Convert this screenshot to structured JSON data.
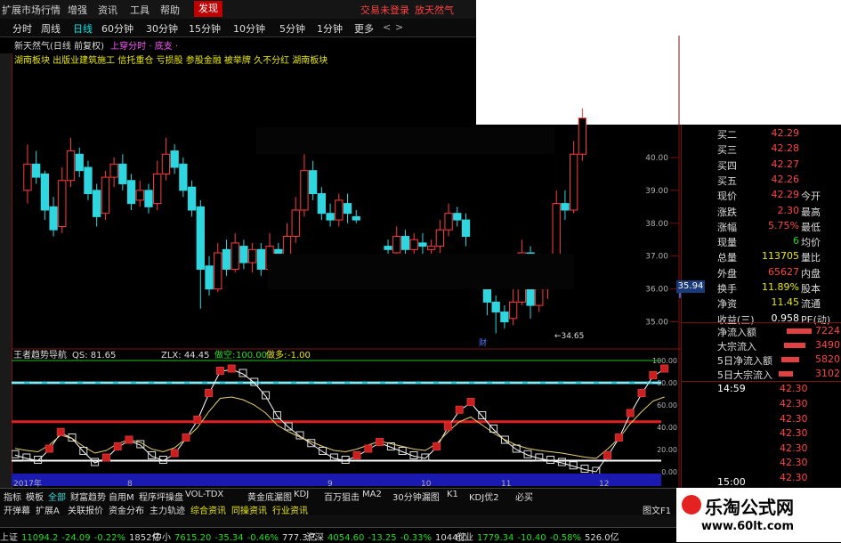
{
  "menu": {
    "items": [
      "扩展市场行情",
      "增强",
      "资讯",
      "工具",
      "帮助",
      "发现"
    ],
    "active": "发现",
    "promo": [
      "交易未登录",
      "放天然气"
    ]
  },
  "periods": {
    "items": [
      "分时",
      "周线",
      "日线",
      "60分钟",
      "30分钟",
      "15分钟",
      "10分钟",
      "5分钟",
      "1分钟",
      "更多"
    ],
    "selected": "日线"
  },
  "info": {
    "title": "新天然气(日线 前复权)",
    "link": "上穿分时",
    "signal": "上穿分时 · 底支 ·",
    "tags": "湖南板块 出版业建筑施工 信托重仓 亏损股 参股金融 被举牌 久不分红 湖南板块"
  },
  "price_axis": {
    "ticks": [
      "40.00",
      "39.00",
      "38.00",
      "37.00",
      "36.00",
      "35.00"
    ]
  },
  "current_price_label": "35.94",
  "low_label": "34.65",
  "finance_marker": "财",
  "indicator": {
    "name": "王者趋势导航",
    "qs": "QS: 81.65",
    "zlx": "ZLX: 44.45",
    "zuokong_label": "做空:",
    "zuokong_value": "100.00",
    "zuoduo_label": "做多:",
    "zuoduo_value": "-1.00"
  },
  "indicator_axis": {
    "ticks": [
      "100.00",
      "80.00",
      "60.00",
      "40.00",
      "20.00",
      "0.00"
    ]
  },
  "time_axis": {
    "labels": [
      "2017年",
      "8",
      "9",
      "10",
      "11",
      "12"
    ]
  },
  "quotes": {
    "rows": [
      {
        "label": "买二",
        "value": "42.29",
        "cls": "red"
      },
      {
        "label": "买三",
        "value": "42.28",
        "cls": "red"
      },
      {
        "label": "买四",
        "value": "42.27",
        "cls": "red"
      },
      {
        "label": "买五",
        "value": "42.26",
        "cls": "red"
      },
      {
        "label": "现价",
        "value": "42.29",
        "extra": "今开",
        "cls": "red"
      },
      {
        "label": "涨跌",
        "value": "2.30",
        "extra": "最高",
        "cls": "red"
      },
      {
        "label": "涨幅",
        "value": "5.75%",
        "extra": "最低",
        "cls": "red"
      },
      {
        "label": "现量",
        "value": "6",
        "extra": "均价",
        "cls": "green"
      },
      {
        "label": "总量",
        "value": "113705",
        "extra": "量比",
        "cls": "yellow"
      },
      {
        "label": "外盘",
        "value": "65627",
        "extra": "内盘",
        "cls": "red"
      },
      {
        "label": "换手",
        "value": "11.89%",
        "extra": "股本",
        "cls": "yellow"
      },
      {
        "label": "净资",
        "value": "11.45",
        "extra": "流通",
        "cls": "yellow"
      },
      {
        "label": "收益(三)",
        "value": "0.958",
        "extra": "PE(动)",
        "cls": "white"
      }
    ],
    "flows": [
      {
        "label": "净流入额",
        "value": "7224"
      },
      {
        "label": "大宗流入",
        "value": "3490"
      },
      {
        "label": "5日净流入额",
        "value": "5820"
      },
      {
        "label": "5日大宗流入",
        "value": "3102"
      }
    ],
    "ticks_time": "14:59",
    "ticks": [
      "42.30",
      "42.30",
      "42.30",
      "42.30",
      "42.30",
      "42.30",
      "42.30",
      "42.30"
    ],
    "end_time": "15:00"
  },
  "bottom_tabs": {
    "items": [
      "指标",
      "模板",
      "全部",
      "财富趋势",
      "自用M",
      "程序坪操盘",
      "VOL-TDX",
      "黄金底漏图",
      "KDJ",
      "百万狙击",
      "MA2",
      "30分钟漏图",
      "K1",
      "KDJ优2",
      "必买"
    ]
  },
  "bottom_bar2": {
    "items": [
      "开弹幕",
      "扩展A",
      "关联报价",
      "资金分布",
      "主力轨迹",
      "综合资讯",
      "同操资讯",
      "行业资讯"
    ],
    "right": "图文F1"
  },
  "statusbar": {
    "items": [
      {
        "name": "上证",
        "text": "11094.2",
        "chg": "-24.09",
        "pct": "-0.22%",
        "amt": "1852亿"
      },
      {
        "name": "中小",
        "text": "7615.20",
        "chg": "-35.34",
        "pct": "-0.46%",
        "amt": "777.3亿"
      },
      {
        "name": "沪深",
        "text": "4054.60",
        "chg": "-13.25",
        "pct": "-0.33%",
        "amt": "1044亿"
      },
      {
        "name": "创业",
        "text": "1779.34",
        "chg": "-10.40",
        "pct": "-0.58%",
        "amt": "526.0亿"
      }
    ]
  },
  "watermark": {
    "title": "乐淘公式网",
    "url": "www.60lt.com"
  },
  "chart_data": {
    "type": "candlestick",
    "candles": [
      [
        39.0,
        39.8,
        38.6,
        40.4
      ],
      [
        39.8,
        39.4,
        39.2,
        40.2
      ],
      [
        39.5,
        38.4,
        38.1,
        39.6
      ],
      [
        38.5,
        37.8,
        37.6,
        38.8
      ],
      [
        37.9,
        39.3,
        37.7,
        39.7
      ],
      [
        39.3,
        40.2,
        39.1,
        40.6
      ],
      [
        40.1,
        39.6,
        39.4,
        40.3
      ],
      [
        39.7,
        38.9,
        38.7,
        39.9
      ],
      [
        39.0,
        38.2,
        37.9,
        39.2
      ],
      [
        38.3,
        39.4,
        38.1,
        39.6
      ],
      [
        39.4,
        39.8,
        39.1,
        40.0
      ],
      [
        39.8,
        39.2,
        39.0,
        40.1
      ],
      [
        39.3,
        38.6,
        38.4,
        39.5
      ],
      [
        38.7,
        39.0,
        38.5,
        39.3
      ],
      [
        39.0,
        38.5,
        38.3,
        39.2
      ],
      [
        38.6,
        39.5,
        38.4,
        39.9
      ],
      [
        39.5,
        40.1,
        39.3,
        40.6
      ],
      [
        40.2,
        39.7,
        39.5,
        40.4
      ],
      [
        39.8,
        39.0,
        38.8,
        40.0
      ],
      [
        39.1,
        38.4,
        38.2,
        39.3
      ],
      [
        38.5,
        36.6,
        35.4,
        38.7
      ],
      [
        36.7,
        36.0,
        35.8,
        37.0
      ],
      [
        36.0,
        37.1,
        35.9,
        37.4
      ],
      [
        37.2,
        36.6,
        36.4,
        37.5
      ],
      [
        36.6,
        37.4,
        36.5,
        37.7
      ],
      [
        37.3,
        36.8,
        36.6,
        37.5
      ],
      [
        36.8,
        37.2,
        36.5,
        37.4
      ],
      [
        37.2,
        36.6,
        36.4,
        37.4
      ],
      [
        36.6,
        37.3,
        36.4,
        37.7
      ],
      [
        37.2,
        36.7,
        36.5,
        37.4
      ],
      [
        36.8,
        37.6,
        36.6,
        38.0
      ],
      [
        37.6,
        38.4,
        37.4,
        38.8
      ],
      [
        38.4,
        39.6,
        38.2,
        40.1
      ],
      [
        39.6,
        38.9,
        38.7,
        39.9
      ],
      [
        38.9,
        38.3,
        38.1,
        39.1
      ],
      [
        38.3,
        38.1,
        37.9,
        38.6
      ],
      [
        38.1,
        38.7,
        37.9,
        38.9
      ],
      [
        38.6,
        38.3,
        38.0,
        38.9
      ],
      [
        38.2,
        38.1,
        38.0,
        38.4
      ],
      [
        37.3,
        37.2,
        36.9,
        37.5
      ],
      [
        37.1,
        37.6,
        36.9,
        37.9
      ],
      [
        37.6,
        37.2,
        37.0,
        37.8
      ],
      [
        37.2,
        37.5,
        37.0,
        37.7
      ],
      [
        37.4,
        37.3,
        37.0,
        37.7
      ],
      [
        37.2,
        37.3,
        37.0,
        37.5
      ],
      [
        37.3,
        37.8,
        37.1,
        38.1
      ],
      [
        37.8,
        38.3,
        37.6,
        38.6
      ],
      [
        38.3,
        38.1,
        37.9,
        38.5
      ],
      [
        38.1,
        37.6,
        37.3,
        38.3
      ],
      [
        36.1,
        35.6,
        35.2,
        36.3
      ],
      [
        35.6,
        35.3,
        34.65,
        35.8
      ],
      [
        35.3,
        35.0,
        34.8,
        35.5
      ],
      [
        35.1,
        35.6,
        34.9,
        36.0
      ],
      [
        35.6,
        37.1,
        35.5,
        37.5
      ],
      [
        37.1,
        35.5,
        35.1,
        37.3
      ],
      [
        35.5,
        36.0,
        35.3,
        36.3
      ],
      [
        36.0,
        36.4,
        35.7,
        36.7
      ],
      [
        36.4,
        38.6,
        36.2,
        39.0
      ],
      [
        38.6,
        38.4,
        38.1,
        39.0
      ],
      [
        38.4,
        40.1,
        38.3,
        40.5
      ],
      [
        40.1,
        41.2,
        39.9,
        41.5
      ]
    ],
    "ylim": [
      34.5,
      41.0
    ]
  }
}
